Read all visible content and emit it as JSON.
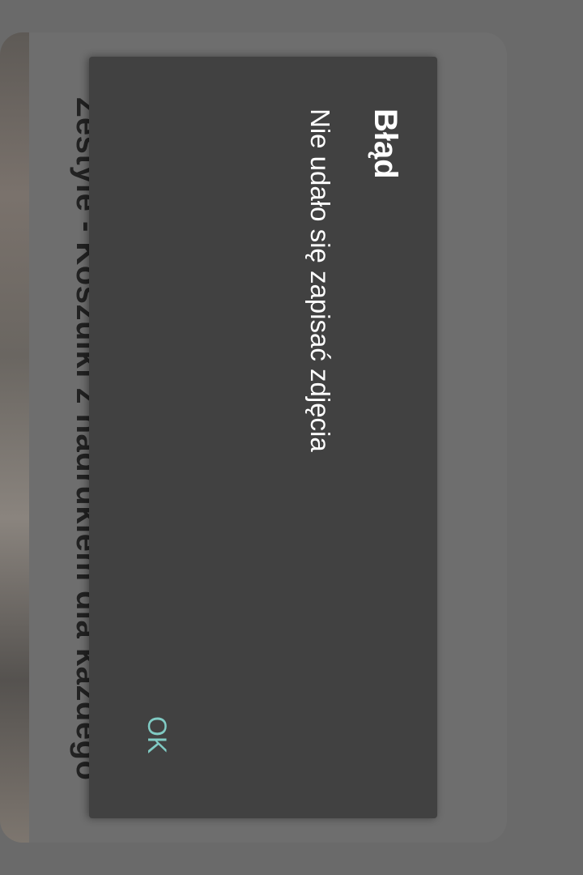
{
  "background_card": {
    "title": "Zestyle - Koszulki z nadrukiem dla każdego"
  },
  "dialog": {
    "title": "Błąd",
    "message": "Nie udało się zapisać zdjęcia",
    "ok_label": "OK"
  },
  "colors": {
    "dialog_bg": "#414141",
    "accent": "#80cbc4",
    "scrim": "#6a6a6a"
  }
}
